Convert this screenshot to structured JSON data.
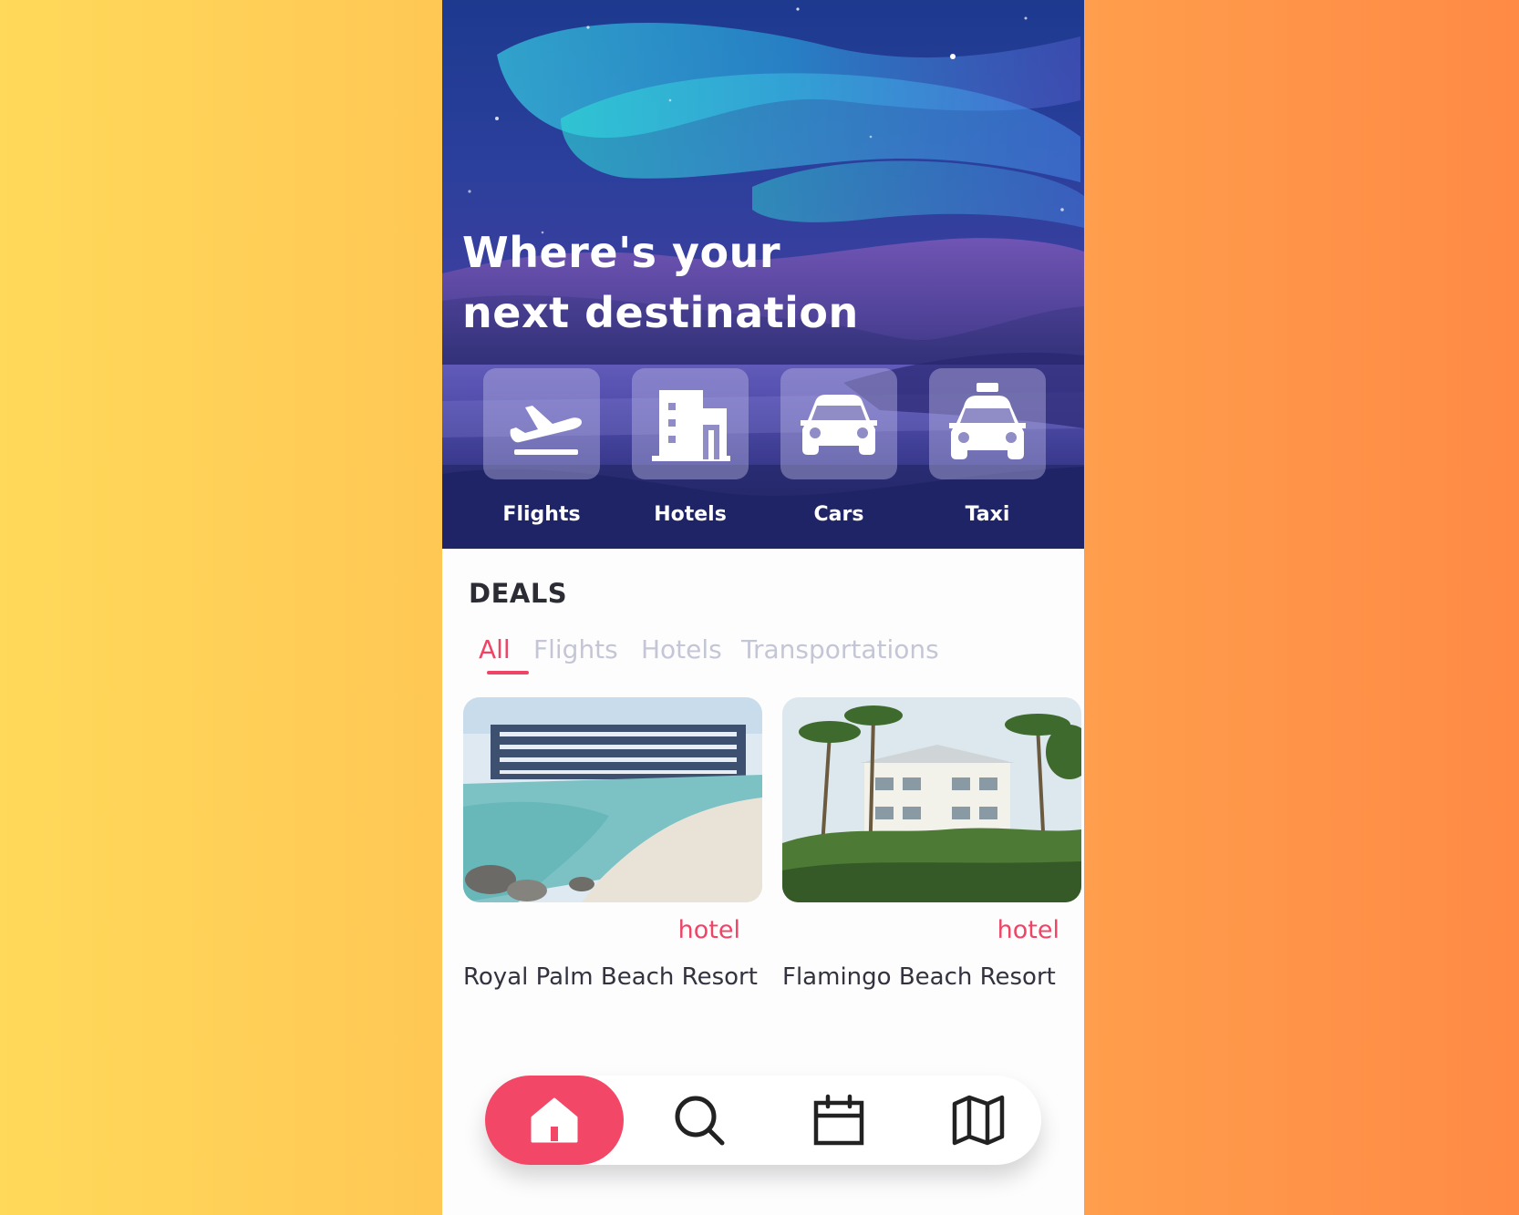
{
  "hero": {
    "title_line1": "Where's your",
    "title_line2": "next destination"
  },
  "categories": [
    {
      "label": "Flights",
      "icon": "plane-departure-icon"
    },
    {
      "label": "Hotels",
      "icon": "building-icon"
    },
    {
      "label": "Cars",
      "icon": "car-icon"
    },
    {
      "label": "Taxi",
      "icon": "taxi-icon"
    }
  ],
  "deals": {
    "title": "DEALS",
    "tabs": [
      "All",
      "Flights",
      "Hotels",
      "Transportations"
    ],
    "active_tab": "All",
    "cards": [
      {
        "tag": "hotel",
        "name": "Royal Palm Beach Resort"
      },
      {
        "tag": "hotel",
        "name": "Flamingo Beach Resort"
      }
    ]
  },
  "nav": {
    "items": [
      "home-icon",
      "search-icon",
      "calendar-icon",
      "map-icon"
    ],
    "active": "home-icon"
  },
  "colors": {
    "accent": "#ef4466",
    "inactive_tab": "#c4c6d6",
    "background_left": "#ffd95a",
    "background_right": "#ff8a45"
  }
}
